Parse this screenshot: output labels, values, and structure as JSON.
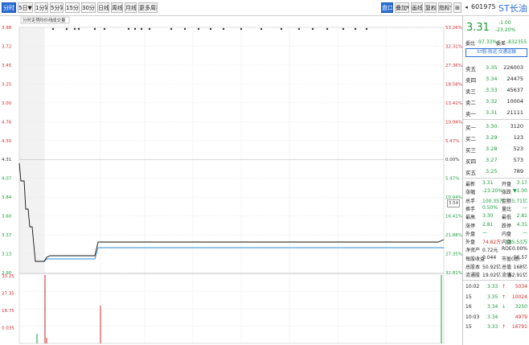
{
  "toolbar": {
    "buttons": [
      "分时",
      "5日▼",
      "1分钟",
      "5分钟",
      "15分钟",
      "30分钟",
      "日线",
      "周线",
      "月线",
      "更多周期▼"
    ],
    "right_buttons": [
      "盘口",
      "叠加▼",
      "画线",
      "复权",
      "指标▼",
      "⊞",
      "◂"
    ],
    "stock_code": "601975",
    "stock_name": "ST长油"
  },
  "chart": {
    "legend_items": [
      "分时走势",
      "均价线",
      "成交量"
    ],
    "price_labels": [
      "3.98",
      "3.72",
      "3.45",
      "3.25",
      "3.00",
      "4.76",
      "4.50",
      "4.31",
      "4.07",
      "3.84",
      "3.60",
      "3.37",
      "3.13",
      "2.90"
    ],
    "pct_labels": [
      "53.26%",
      "32.31%",
      "27.36%",
      "18.58%",
      "13.41%",
      "10.94%",
      "5.47%",
      "0.00%",
      "5.47%",
      "10.94%",
      "16.41%",
      "21.88%",
      "27.35%",
      "32.81%"
    ],
    "price_tip": "3.54",
    "vol_labels": [
      "33.25",
      "27.35",
      "18.75",
      "0.035"
    ],
    "colors": {
      "price_line": "#111111",
      "avg_line": "#2a8ad8",
      "vol_bar_red": "#d42a2a",
      "vol_bar_green": "#1a9c3a",
      "grid": "#e8e8e8",
      "up_text": "#d42a2a",
      "down_text": "#1a9c3a"
    }
  },
  "panel": {
    "last_price": "3.31",
    "change": "-1.00",
    "change_pct": "-23.20%",
    "ratio_label": "委比",
    "ratio_value": "-97.33%",
    "diff_label": "委差",
    "diff_value": "-832355",
    "theme_button": "ST股·航运·交通运输",
    "sell": [
      {
        "label": "卖五",
        "price": "3.35",
        "vol": "226003"
      },
      {
        "label": "卖四",
        "price": "3.34",
        "vol": "24475"
      },
      {
        "label": "卖三",
        "price": "3.33",
        "vol": "45637"
      },
      {
        "label": "卖二",
        "price": "3.32",
        "vol": "10004"
      },
      {
        "label": "卖一",
        "price": "3.31",
        "vol": "21111"
      }
    ],
    "buy": [
      {
        "label": "买一",
        "price": "3.30",
        "vol": "3120"
      },
      {
        "label": "买二",
        "price": "3.29",
        "vol": "123"
      },
      {
        "label": "买三",
        "price": "3.28",
        "vol": "523"
      },
      {
        "label": "买四",
        "price": "3.27",
        "vol": "573"
      },
      {
        "label": "买五",
        "price": "3.25",
        "vol": "789"
      }
    ],
    "stats": [
      {
        "l1": "最新",
        "v1": "3.31",
        "l2": "开盘",
        "v2": "3.17"
      },
      {
        "l1": "涨幅",
        "v1": "-23.20%",
        "l2": "涨跌",
        "v2": "▼1.00"
      },
      {
        "l1": "总手",
        "v1": "100.35万",
        "l2": "金额",
        "v2": "5.71亿"
      },
      {
        "l1": "换手",
        "v1": "0.50%",
        "l2": "量比",
        "v2": "—"
      },
      {
        "l1": "最高",
        "v1": "3.30",
        "l2": "最低",
        "v2": "2.81"
      },
      {
        "l1": "涨停",
        "v1": "2.81",
        "l2": "跌停",
        "v2": "4.31"
      },
      {
        "l1": "外盘",
        "v1": "—",
        "l2": "内盘",
        "v2": "—"
      },
      {
        "l1": "外盘",
        "v1": "74.82万",
        "l2": "内盘",
        "v2": "185.53万"
      },
      {
        "l1": "净资产",
        "v1": "0.72元",
        "l2": "ROE",
        "v2": "0.00%"
      },
      {
        "l1": "每股收益",
        "v1": "0.044",
        "l2": "市盈(动)",
        "v2": "56.57"
      },
      {
        "l1": "总股本",
        "v1": "50.92亿",
        "l2": "总值",
        "v2": "168亿"
      },
      {
        "l1": "流通股",
        "v1": "19.02亿",
        "l2": "流值",
        "v2": "62.91亿"
      }
    ],
    "ticks": [
      {
        "time": "10:02",
        "price": "3.33",
        "dir": "↑",
        "vol": "5034"
      },
      {
        "time": "15",
        "price": "3.35",
        "dir": "↑",
        "vol": "10024"
      },
      {
        "time": "16",
        "price": "3.34",
        "dir": "↓",
        "vol": "3250"
      },
      {
        "time": "10:03",
        "price": "3.34",
        "dir": "",
        "vol": "4979"
      },
      {
        "time": "15",
        "price": "3.33",
        "dir": "↑",
        "vol": "16791"
      }
    ]
  }
}
